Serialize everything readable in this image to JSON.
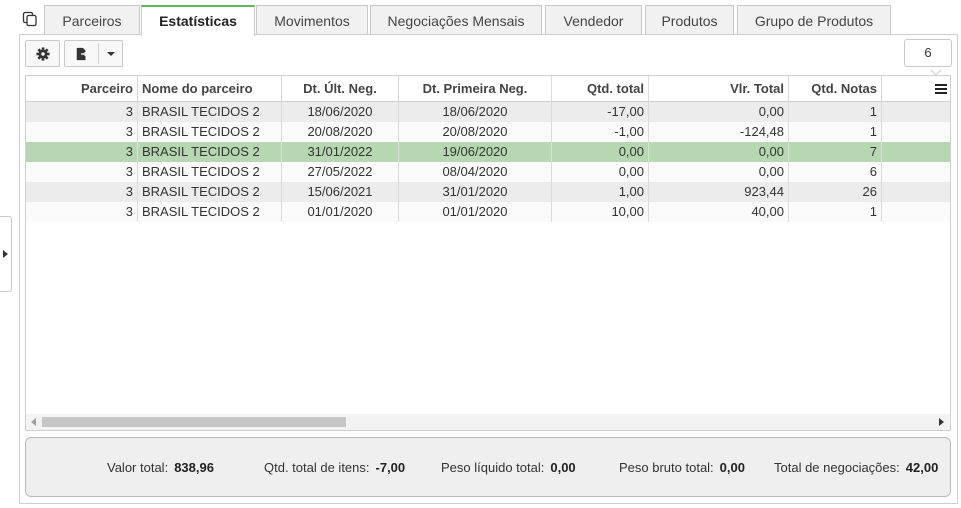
{
  "tabs": [
    {
      "label": "Parceiros"
    },
    {
      "label": "Estatísticas"
    },
    {
      "label": "Movimentos"
    },
    {
      "label": "Negociações Mensais"
    },
    {
      "label": "Vendedor"
    },
    {
      "label": "Produtos"
    },
    {
      "label": "Grupo de Produtos"
    }
  ],
  "active_tab": "Estatísticas",
  "toolbar": {
    "record_count": "6"
  },
  "table": {
    "columns": [
      "Parceiro",
      "Nome do parceiro",
      "Dt. Últ. Neg.",
      "Dt. Primeira Neg.",
      "Qtd. total",
      "Vlr. Total",
      "Qtd. Notas"
    ],
    "rows": [
      {
        "parceiro": "3",
        "nome": "BRASIL TECIDOS 2",
        "dt_ult": "18/06/2020",
        "dt_primeira": "18/06/2020",
        "qtd_total": "-17,00",
        "vlr_total": "0,00",
        "qtd_notas": "1"
      },
      {
        "parceiro": "3",
        "nome": "BRASIL TECIDOS 2",
        "dt_ult": "20/08/2020",
        "dt_primeira": "20/08/2020",
        "qtd_total": "-1,00",
        "vlr_total": "-124,48",
        "qtd_notas": "1"
      },
      {
        "parceiro": "3",
        "nome": "BRASIL TECIDOS 2",
        "dt_ult": "31/01/2022",
        "dt_primeira": "19/06/2020",
        "qtd_total": "0,00",
        "vlr_total": "0,00",
        "qtd_notas": "7"
      },
      {
        "parceiro": "3",
        "nome": "BRASIL TECIDOS 2",
        "dt_ult": "27/05/2022",
        "dt_primeira": "08/04/2020",
        "qtd_total": "0,00",
        "vlr_total": "0,00",
        "qtd_notas": "6"
      },
      {
        "parceiro": "3",
        "nome": "BRASIL TECIDOS 2",
        "dt_ult": "15/06/2021",
        "dt_primeira": "31/01/2020",
        "qtd_total": "1,00",
        "vlr_total": "923,44",
        "qtd_notas": "26"
      },
      {
        "parceiro": "3",
        "nome": "BRASIL TECIDOS 2",
        "dt_ult": "01/01/2020",
        "dt_primeira": "01/01/2020",
        "qtd_total": "10,00",
        "vlr_total": "40,00",
        "qtd_notas": "1"
      }
    ],
    "selected_row": 2
  },
  "footer": {
    "valor_total_label": "Valor total:",
    "valor_total": "838,96",
    "qtd_itens_label": "Qtd. total de itens:",
    "qtd_itens": "-7,00",
    "peso_liquido_label": "Peso líquido total:",
    "peso_liquido": "0,00",
    "peso_bruto_label": "Peso bruto total:",
    "peso_bruto": "0,00",
    "negociacoes_label": "Total de negociações:",
    "negociacoes": "42,00"
  },
  "colors": {
    "active_tab_accent": "#5cb85c",
    "selected_row": "#b7d7b2"
  },
  "icons": [
    "copy-icon",
    "gear-icon",
    "export-icon",
    "caret-down-icon",
    "column-menu-icon",
    "expand-arrow-icon"
  ]
}
